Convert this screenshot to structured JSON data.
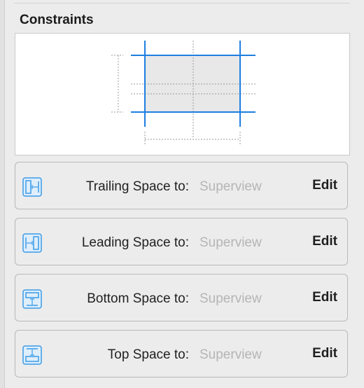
{
  "section": {
    "title": "Constraints"
  },
  "colors": {
    "accent": "#1d7fe0",
    "icon_blue": "#3a9be8",
    "placeholder_text": "#b5b5b5"
  },
  "constraints": [
    {
      "icon": "trailing-space-icon",
      "label": "Trailing Space to:",
      "target": "Superview",
      "edit_label": "Edit"
    },
    {
      "icon": "leading-space-icon",
      "label": "Leading Space to:",
      "target": "Superview",
      "edit_label": "Edit"
    },
    {
      "icon": "bottom-space-icon",
      "label": "Bottom Space to:",
      "target": "Superview",
      "edit_label": "Edit"
    },
    {
      "icon": "top-space-icon",
      "label": "Top Space to:",
      "target": "Superview",
      "edit_label": "Edit"
    }
  ]
}
